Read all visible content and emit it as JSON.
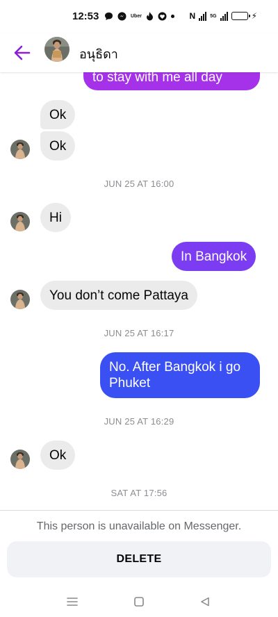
{
  "status_bar": {
    "time": "12:53",
    "notification_icons": [
      "chat-icon",
      "messenger-icon",
      "uber-icon",
      "tinder-icon",
      "heart-app-icon",
      "dot-icon"
    ],
    "uber_label": "Uber",
    "network_label": "5G"
  },
  "header": {
    "contact_name": "อนุธิดา",
    "back_icon": "arrow-left-icon"
  },
  "colors": {
    "accent": "#8b1fd6",
    "bubble_purple": "#a532e8",
    "bubble_violet": "#7b3cf2",
    "bubble_blue": "#3a50f3",
    "incoming_bubble": "#ebebeb",
    "timestamp": "#8a8d91"
  },
  "messages": [
    {
      "id": "m0",
      "direction": "out",
      "text": "to stay with me all day"
    },
    {
      "id": "m1",
      "direction": "in",
      "text": "Ok"
    },
    {
      "id": "m2",
      "direction": "in",
      "text": "Ok"
    },
    {
      "id": "t1",
      "type": "timestamp",
      "text": "JUN 25 AT 16:00"
    },
    {
      "id": "m3",
      "direction": "in",
      "text": "Hi"
    },
    {
      "id": "m4",
      "direction": "out",
      "text": "In Bangkok"
    },
    {
      "id": "m5",
      "direction": "in",
      "text": "You don’t come Pattaya"
    },
    {
      "id": "t2",
      "type": "timestamp",
      "text": "JUN 25 AT 16:17"
    },
    {
      "id": "m6",
      "direction": "out",
      "text": "No. After Bangkok i go Phuket"
    },
    {
      "id": "t3",
      "type": "timestamp",
      "text": "JUN 25 AT 16:29"
    },
    {
      "id": "m7",
      "direction": "in",
      "text": "Ok"
    },
    {
      "id": "t4",
      "type": "timestamp",
      "text": "SAT AT 17:56"
    }
  ],
  "notice": {
    "text": "This person is unavailable on Messenger.",
    "delete_label": "DELETE"
  },
  "nav_bar": {
    "icons": [
      "menu-icon",
      "home-square-icon",
      "back-triangle-icon"
    ]
  }
}
